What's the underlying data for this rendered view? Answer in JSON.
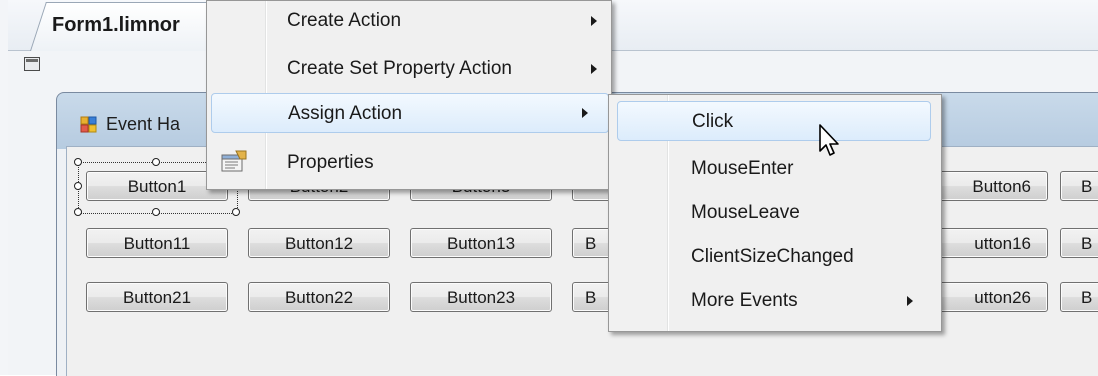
{
  "document_tab": {
    "label": "Form1.limnor"
  },
  "form": {
    "title": "Event Ha"
  },
  "buttons": {
    "row1": [
      "Button1",
      "Button2",
      "Button3",
      "Button6",
      "B"
    ],
    "row2": [
      "Button11",
      "Button12",
      "Button13",
      "B",
      "utton16",
      "B"
    ],
    "row3": [
      "Button21",
      "Button22",
      "Button23",
      "B",
      "utton26",
      "B"
    ]
  },
  "context_menu": {
    "items": [
      {
        "label": "Create Action",
        "has_submenu": true
      },
      {
        "label": "Create Set Property Action",
        "has_submenu": true
      },
      {
        "label": "Assign Action",
        "has_submenu": true,
        "highlighted": true
      },
      {
        "label": "Properties",
        "icon": "properties-icon"
      }
    ]
  },
  "submenu": {
    "items": [
      {
        "label": "Click",
        "highlighted": true
      },
      {
        "label": "MouseEnter"
      },
      {
        "label": "MouseLeave"
      },
      {
        "label": "ClientSizeChanged"
      },
      {
        "label": "More Events",
        "has_submenu": true
      }
    ]
  },
  "colors": {
    "highlight_border": "#aeccec",
    "highlight_fill": "#dcecfc",
    "menu_bg": "#f0f0f0"
  }
}
